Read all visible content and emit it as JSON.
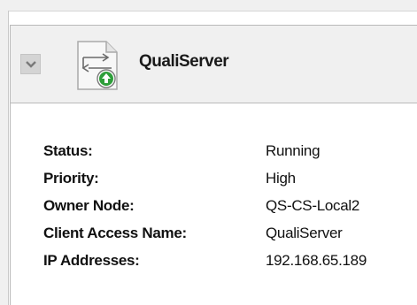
{
  "header": {
    "title": "QualiServer",
    "collapse_icon": "chevron-down-icon",
    "role_icon": "clustered-role-document-icon"
  },
  "properties": [
    {
      "label": "Status:",
      "value": "Running"
    },
    {
      "label": "Priority:",
      "value": "High"
    },
    {
      "label": "Owner Node:",
      "value": "QS-CS-Local2"
    },
    {
      "label": "Client Access Name:",
      "value": "QualiServer"
    },
    {
      "label": "IP Addresses:",
      "value": "192.168.65.189"
    }
  ],
  "colors": {
    "header_bg": "#f0f0f0",
    "border": "#b9b9b9",
    "status_arrow": "#2e9e3a"
  }
}
